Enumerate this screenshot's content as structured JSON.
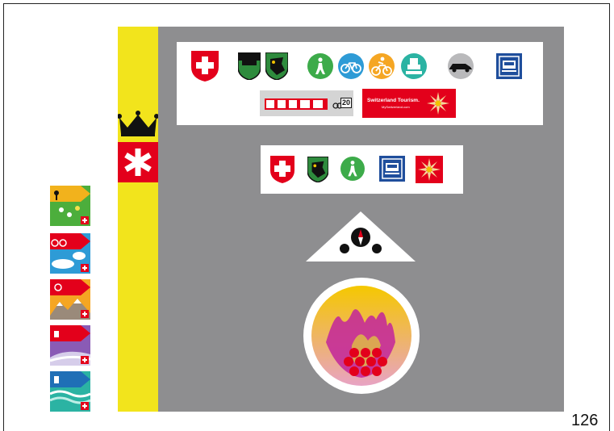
{
  "page": {
    "number": "126"
  },
  "colors": {
    "grey": "#8e8e90",
    "yellow": "#f2e41c",
    "swiss_red": "#e3001b",
    "green": "#3dab4a",
    "blue": "#2e9bd6",
    "orange": "#f5a623",
    "teal": "#2bb3a3",
    "navy": "#1f4e9c"
  },
  "signs": {
    "large_panel": [
      "swiss-cross-shield-icon",
      "cantonal-shield-icon",
      "bear-shield-icon",
      "hiking-icon",
      "cycling-icon",
      "mountainbike-icon",
      "skating-icon",
      "car-icon",
      "train-icon"
    ],
    "route_label": "20",
    "tourism_brand": "Switzerland Tourism.",
    "tourism_url": "MySwitzerland.com",
    "small_panel": [
      "swiss-cross-shield-icon",
      "bear-shield-icon",
      "hiking-icon",
      "train-icon",
      "edelweiss-icon"
    ]
  },
  "strips": [
    "hiking-strip",
    "cycling-strip",
    "mountainbike-strip",
    "skating-strip",
    "canoe-strip"
  ]
}
